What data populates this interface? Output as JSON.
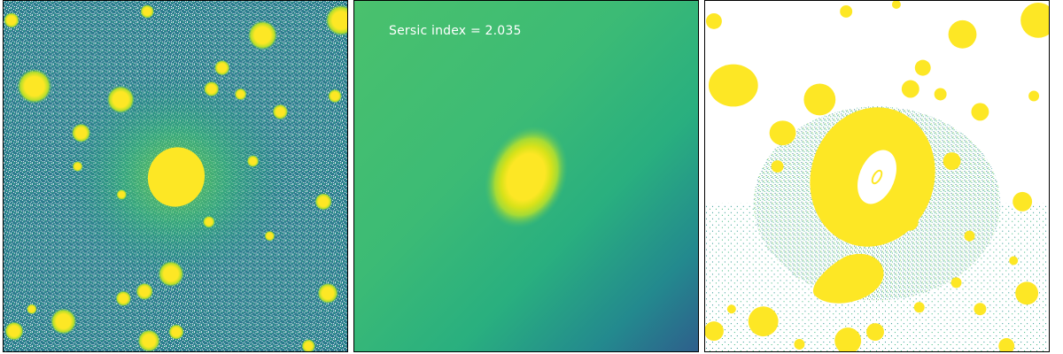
{
  "figure": {
    "panels": [
      {
        "id": "data",
        "colormap": "viridis"
      },
      {
        "id": "model",
        "colormap": "viridis",
        "annotation": "Sersic index = 2.035"
      },
      {
        "id": "residual",
        "colormap": "viridis"
      }
    ]
  },
  "colors": {
    "viridis_yellow": "#fde725",
    "viridis_green": "#47c16e",
    "viridis_teal": "#21918c",
    "viridis_blue": "#31688e",
    "background": "#ffffff"
  }
}
